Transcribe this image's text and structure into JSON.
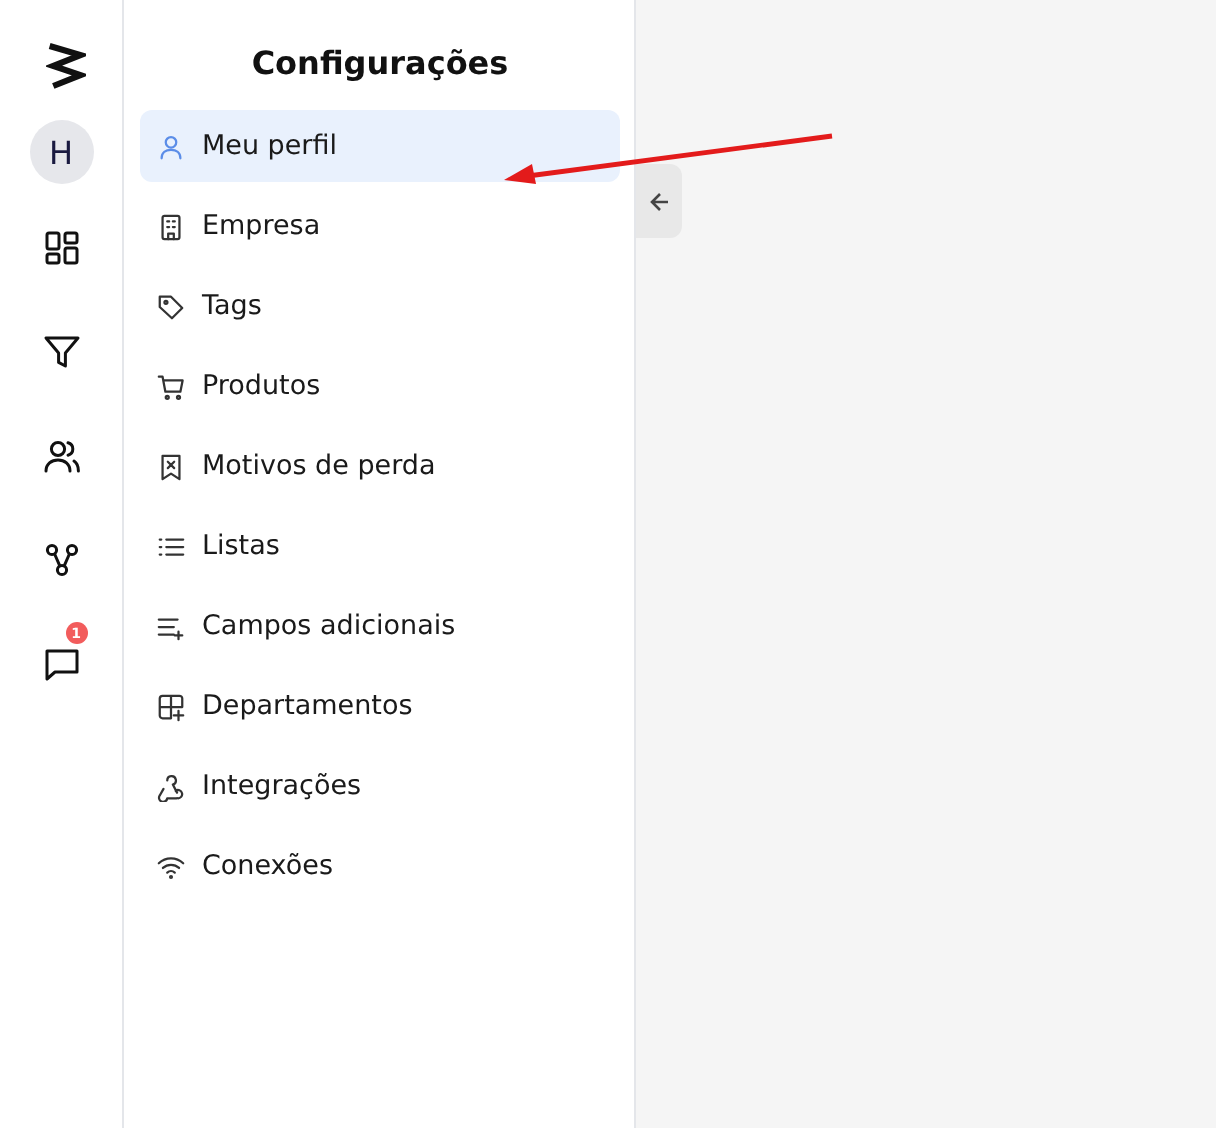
{
  "rail": {
    "avatar": "H",
    "notification_count": "1"
  },
  "settings": {
    "title": "Configurações",
    "items": [
      {
        "label": "Meu perfil",
        "selected": true
      },
      {
        "label": "Empresa",
        "selected": false
      },
      {
        "label": "Tags",
        "selected": false
      },
      {
        "label": "Produtos",
        "selected": false
      },
      {
        "label": "Motivos de perda",
        "selected": false
      },
      {
        "label": "Listas",
        "selected": false
      },
      {
        "label": "Campos adicionais",
        "selected": false
      },
      {
        "label": "Departamentos",
        "selected": false
      },
      {
        "label": "Integrações",
        "selected": false
      },
      {
        "label": "Conexões",
        "selected": false
      }
    ]
  }
}
